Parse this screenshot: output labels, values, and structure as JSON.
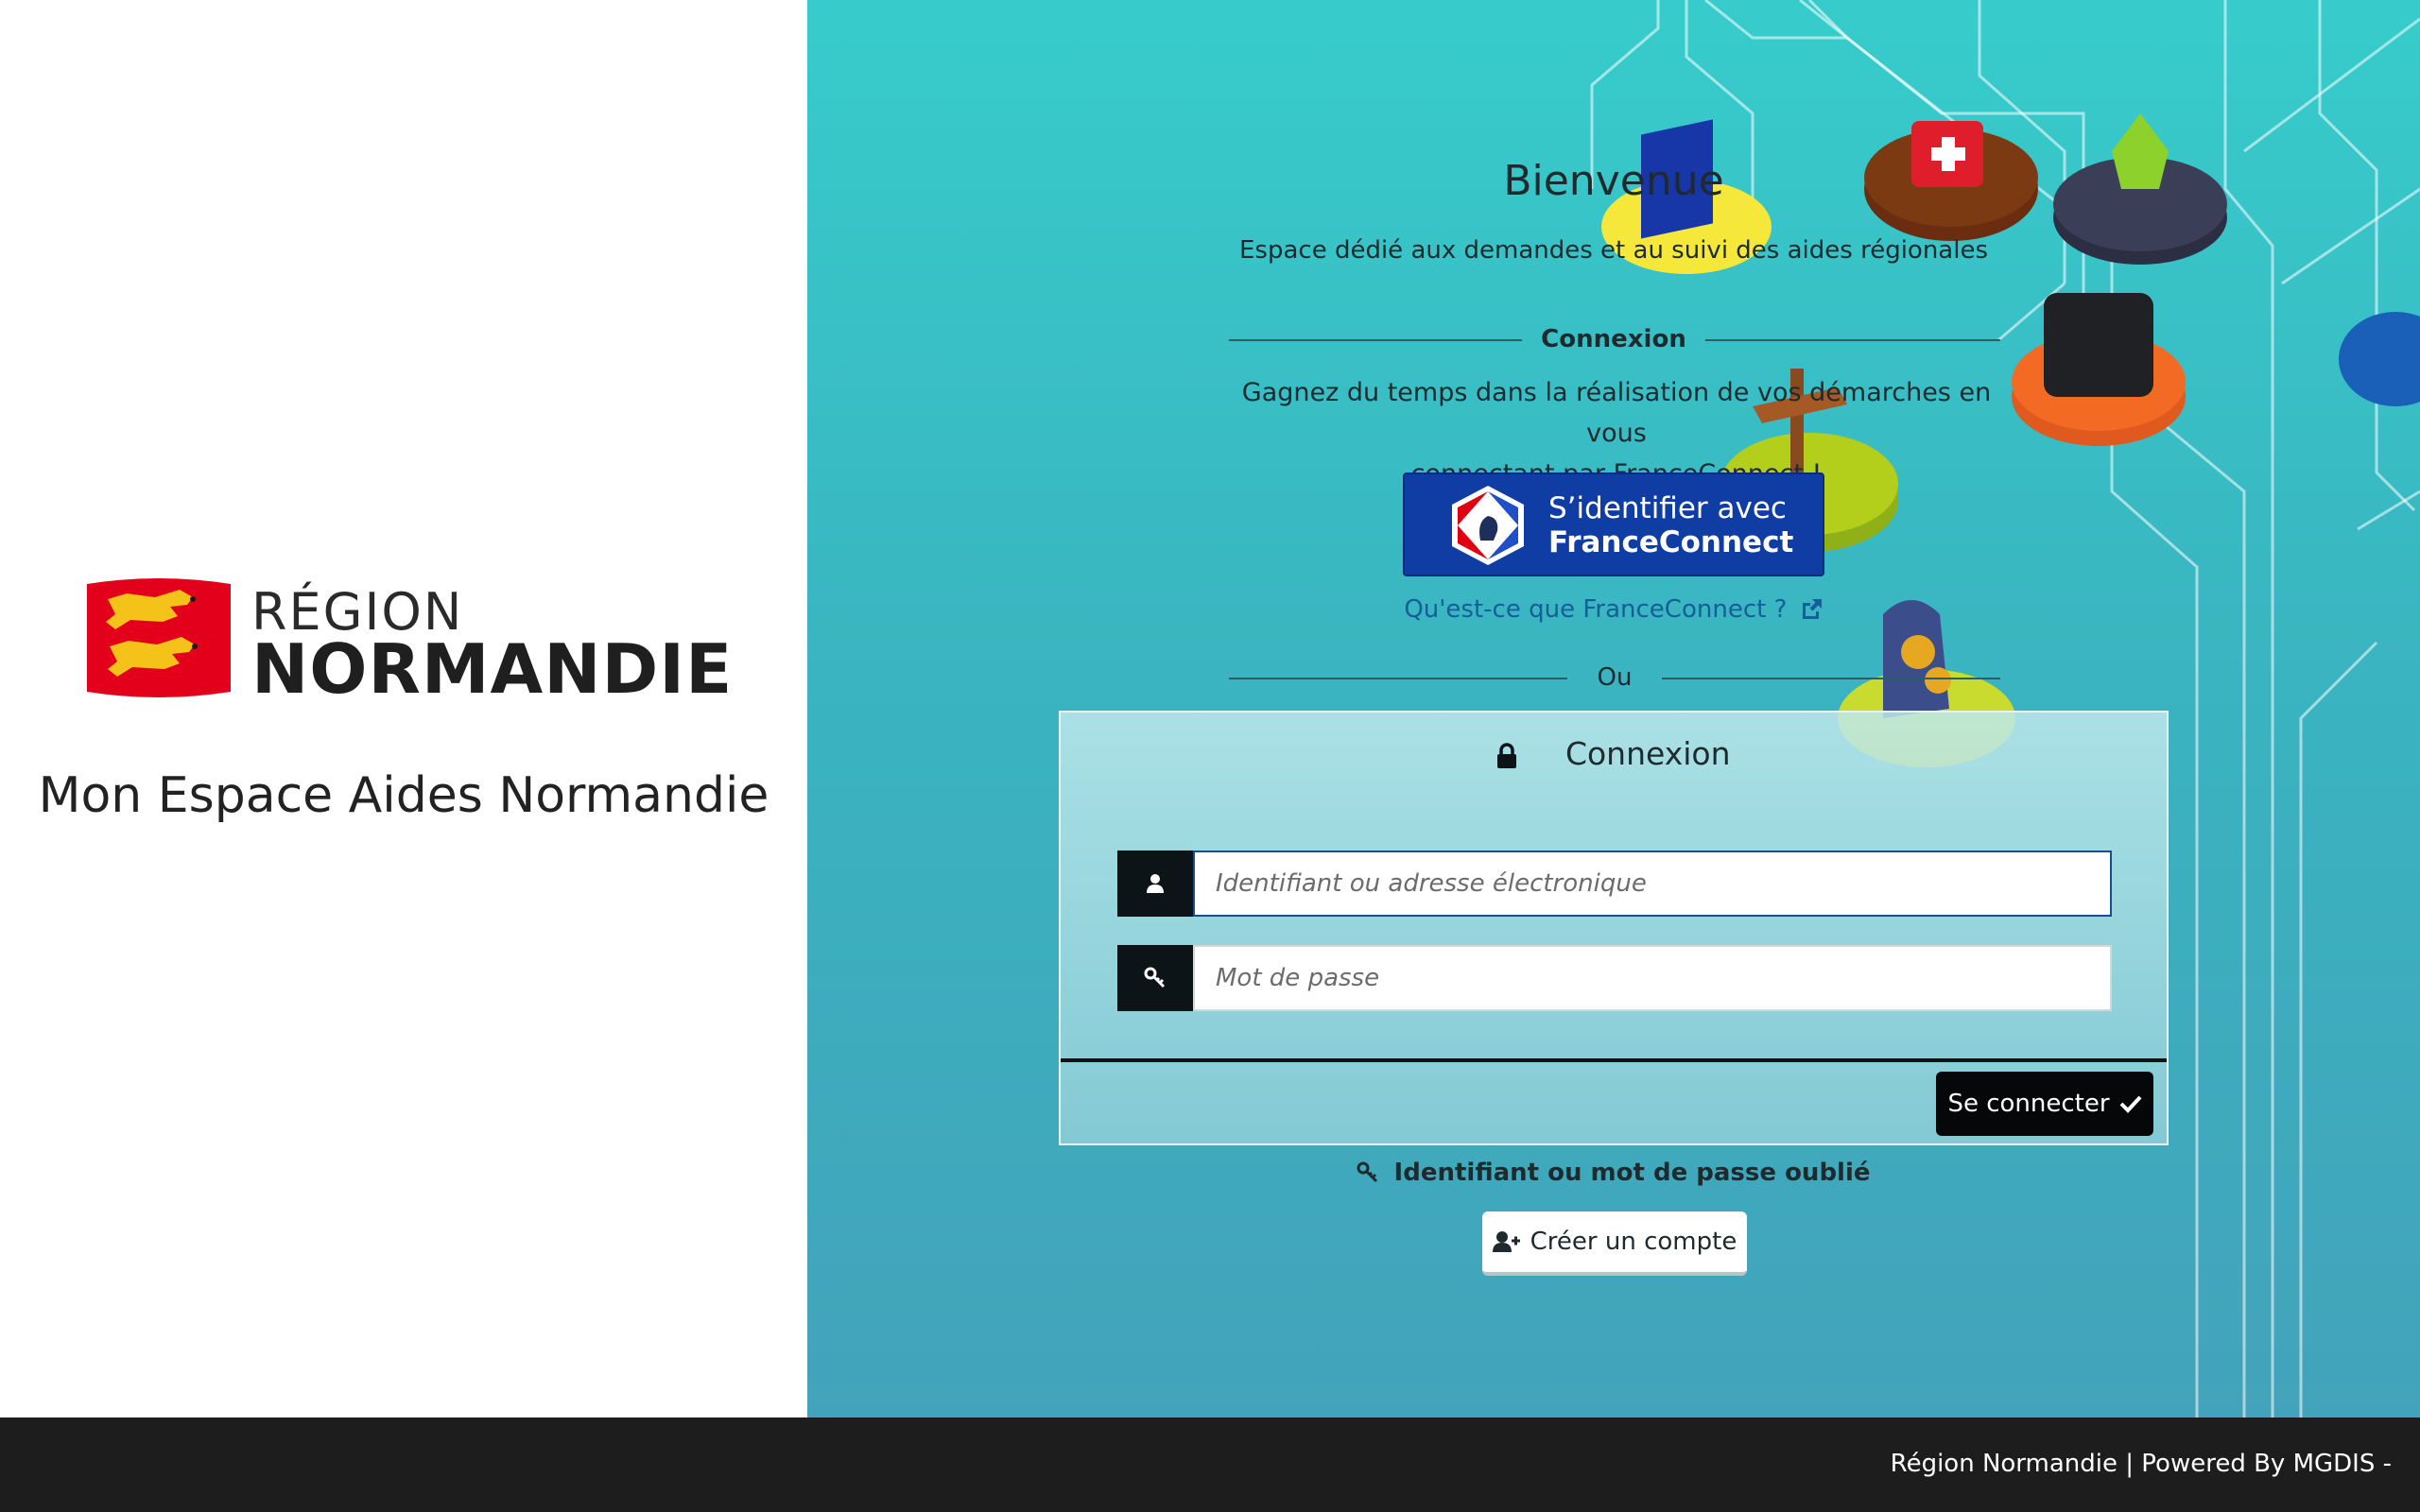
{
  "left_panel": {
    "logo_line1": "RÉGION",
    "logo_line2": "NORMANDIE",
    "app_title": "Mon Espace Aides Normandie"
  },
  "welcome": {
    "title": "Bienvenue",
    "subtitle": "Espace dédié aux demandes et au suivi des aides régionales"
  },
  "franceconnect": {
    "section_label": "Connexion",
    "intro_line1": "Gagnez du temps dans la réalisation de vos démarches en vous",
    "intro_line2": "connectant par FranceConnect !",
    "button_line1": "S’identifier avec",
    "button_line2": "FranceConnect",
    "help_link": "Qu'est-ce que FranceConnect ?"
  },
  "or_label": "Ou",
  "login_panel": {
    "title": "Connexion",
    "username_placeholder": "Identifiant ou adresse électronique",
    "password_placeholder": "Mot de passe",
    "submit_label": "Se connecter"
  },
  "forgot_label": "Identifiant ou mot de passe oublié",
  "create_account_label": "Créer un compte",
  "footer": {
    "text": "Région Normandie | Powered By MGDIS -"
  },
  "colors": {
    "accent_teal": "#37cccb",
    "franceconnect_blue": "#0f3da3",
    "dark": "#050708",
    "footer_bg": "#1d1d1d",
    "flag_red": "#e3001b",
    "lion_gold": "#f5c21a"
  },
  "icons": [
    "lock-icon",
    "user-icon",
    "key-icon",
    "check-icon",
    "external-link-icon",
    "add-user-icon"
  ]
}
